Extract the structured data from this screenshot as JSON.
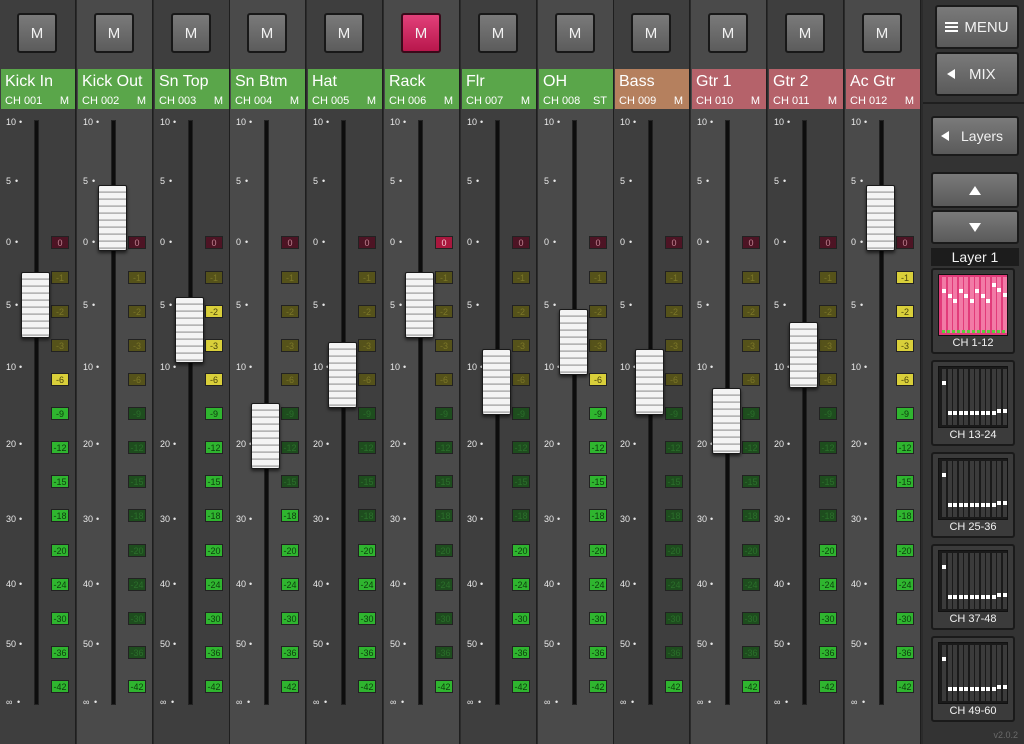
{
  "channels": [
    {
      "name": "Kick In",
      "ch": "CH 001",
      "mode": "M",
      "muted": false,
      "color": "#5aa64a"
    },
    {
      "name": "Kick Out",
      "ch": "CH 002",
      "mode": "M",
      "muted": false,
      "color": "#5aa64a"
    },
    {
      "name": "Sn Top",
      "ch": "CH 003",
      "mode": "M",
      "muted": false,
      "color": "#5aa64a"
    },
    {
      "name": "Sn Btm",
      "ch": "CH 004",
      "mode": "M",
      "muted": false,
      "color": "#5aa64a"
    },
    {
      "name": "Hat",
      "ch": "CH 005",
      "mode": "M",
      "muted": false,
      "color": "#5aa64a"
    },
    {
      "name": "Rack",
      "ch": "CH 006",
      "mode": "M",
      "muted": true,
      "color": "#5aa64a"
    },
    {
      "name": "Flr",
      "ch": "CH 007",
      "mode": "M",
      "muted": false,
      "color": "#5aa64a"
    },
    {
      "name": "OH",
      "ch": "CH 008",
      "mode": "ST",
      "muted": false,
      "color": "#5aa64a"
    },
    {
      "name": "Bass",
      "ch": "CH 009",
      "mode": "M",
      "muted": false,
      "color": "#b5805e"
    },
    {
      "name": "Gtr 1",
      "ch": "CH 010",
      "mode": "M",
      "muted": false,
      "color": "#b5626a"
    },
    {
      "name": "Gtr 2",
      "ch": "CH 011",
      "mode": "M",
      "muted": false,
      "color": "#b5626a"
    },
    {
      "name": "Ac Gtr",
      "ch": "CH 012",
      "mode": "M",
      "muted": false,
      "color": "#b5626a"
    }
  ],
  "mute_label": "M",
  "fader_scale": [
    "10",
    "5",
    "0",
    "5",
    "10",
    "20",
    "30",
    "40",
    "50",
    "∞"
  ],
  "meter_labels": [
    "0",
    "-1",
    "-2",
    "-3",
    "-6",
    "-9",
    "-12",
    "-15",
    "-18",
    "-20",
    "-24",
    "-30",
    "-36",
    "-42"
  ],
  "fader_levels_db": [
    5,
    -2,
    7,
    19,
    11,
    5,
    12,
    8,
    12,
    17,
    9,
    -2
  ],
  "meter_lit_from": [
    4,
    13,
    2,
    8,
    9,
    13,
    9,
    4,
    13,
    13,
    9,
    1
  ],
  "colors": {
    "accent_mute": "#d22a63",
    "meter_green": "#2fb52f",
    "meter_yellow": "#d9cf3a",
    "meter_red": "#a8173d"
  },
  "panel": {
    "menu_label": "MENU",
    "mix_label": "MIX",
    "layers_label": "Layers",
    "up_icon": "arrow-up-icon",
    "down_icon": "arrow-down-icon",
    "layer_title": "Layer 1",
    "banks": [
      {
        "label": "CH 1-12",
        "active": true
      },
      {
        "label": "CH 13-24",
        "active": false
      },
      {
        "label": "CH 25-36",
        "active": false
      },
      {
        "label": "CH 37-48",
        "active": false
      },
      {
        "label": "CH 49-60",
        "active": false
      }
    ]
  },
  "version": "v2.0.2"
}
